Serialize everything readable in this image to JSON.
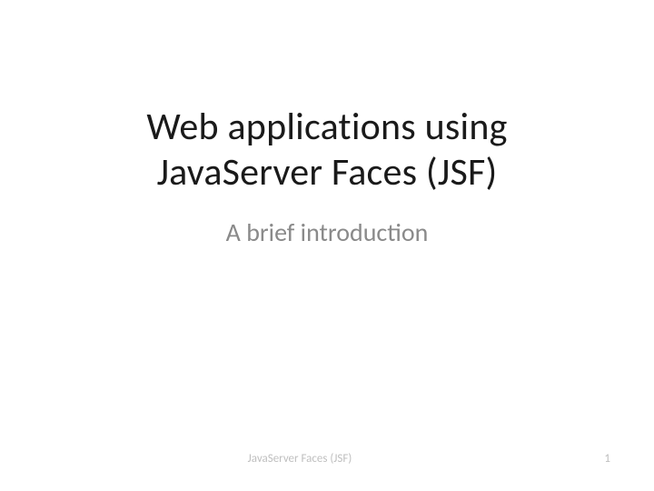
{
  "slide": {
    "title_line1": "Web applications using",
    "title_line2": "JavaServer Faces (JSF)",
    "subtitle": "A brief introduction"
  },
  "footer": {
    "text": "JavaServer Faces (JSF)",
    "page_number": "1"
  }
}
